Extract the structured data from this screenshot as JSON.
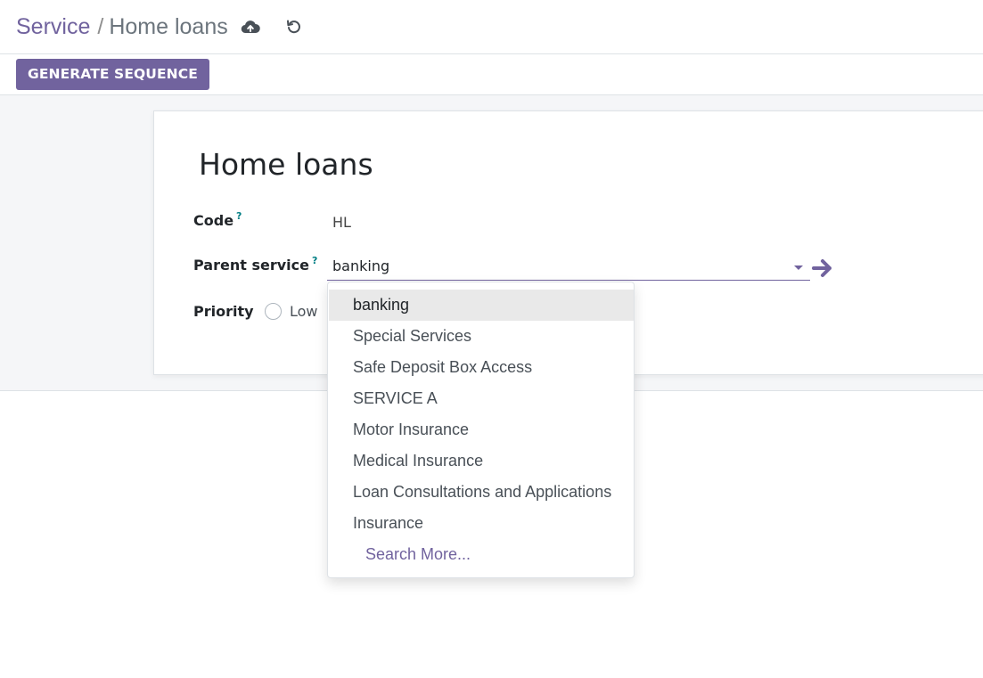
{
  "breadcrumb": {
    "parent": "Service",
    "separator": "/",
    "current": "Home loans"
  },
  "header_icons": {
    "save": "cloud-upload-icon",
    "discard": "undo-icon"
  },
  "actions": {
    "generate_label": "GENERATE SEQUENCE"
  },
  "form": {
    "title": "Home loans",
    "code": {
      "label": "Code",
      "help": "?",
      "value": "HL"
    },
    "parent_service": {
      "label": "Parent service",
      "help": "?",
      "value": "banking"
    },
    "priority": {
      "label": "Priority",
      "option": "Low"
    }
  },
  "dropdown": {
    "items": [
      "banking",
      "Special Services",
      "Safe Deposit Box Access",
      "SERVICE A",
      "Motor Insurance",
      "Medical Insurance",
      "Loan Consultations and Applications",
      "Insurance"
    ],
    "search_more": "Search More..."
  },
  "colors": {
    "brand": "#71639e",
    "help": "#017e84"
  }
}
